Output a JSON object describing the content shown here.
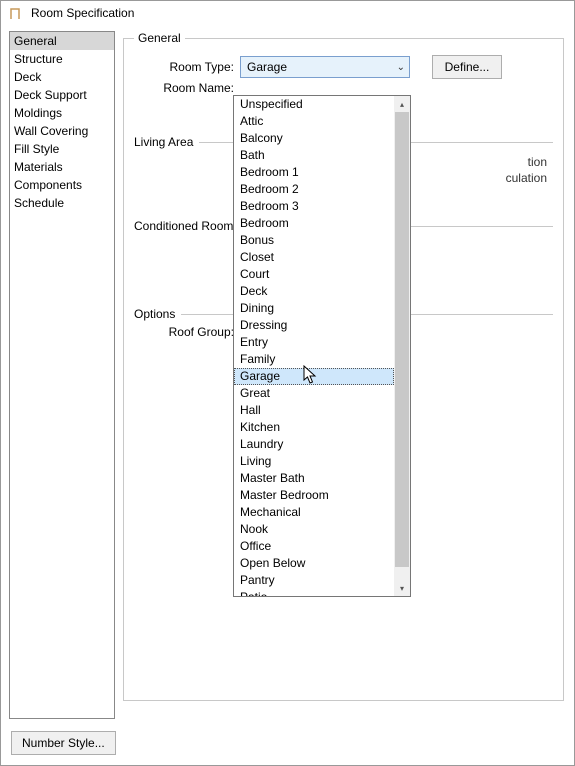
{
  "window": {
    "title": "Room Specification"
  },
  "sidebar": {
    "items": [
      {
        "label": "General",
        "selected": true
      },
      {
        "label": "Structure",
        "selected": false
      },
      {
        "label": "Deck",
        "selected": false
      },
      {
        "label": "Deck Support",
        "selected": false
      },
      {
        "label": "Moldings",
        "selected": false
      },
      {
        "label": "Wall Covering",
        "selected": false
      },
      {
        "label": "Fill Style",
        "selected": false
      },
      {
        "label": "Materials",
        "selected": false
      },
      {
        "label": "Components",
        "selected": false
      },
      {
        "label": "Schedule",
        "selected": false
      }
    ]
  },
  "panel": {
    "title": "General",
    "room_type_label": "Room Type:",
    "room_type_value": "Garage",
    "define_button": "Define...",
    "room_name_label": "Room Name:",
    "living_area_label": "Living Area",
    "conditioned_room_label": "Conditioned Room",
    "options_label": "Options",
    "roof_group_label": "Roof Group:",
    "obscured_1": "tion",
    "obscured_2": "culation"
  },
  "footer": {
    "number_style": "Number Style..."
  },
  "dropdown": {
    "highlighted": "Garage",
    "options": [
      "Unspecified",
      "Attic",
      "Balcony",
      "Bath",
      "Bedroom 1",
      "Bedroom 2",
      "Bedroom 3",
      "Bedroom",
      "Bonus",
      "Closet",
      "Court",
      "Deck",
      "Dining",
      "Dressing",
      "Entry",
      "Family",
      "Garage",
      "Great",
      "Hall",
      "Kitchen",
      "Laundry",
      "Living",
      "Master Bath",
      "Master Bedroom",
      "Mechanical",
      "Nook",
      "Office",
      "Open Below",
      "Pantry",
      "Patio"
    ]
  }
}
